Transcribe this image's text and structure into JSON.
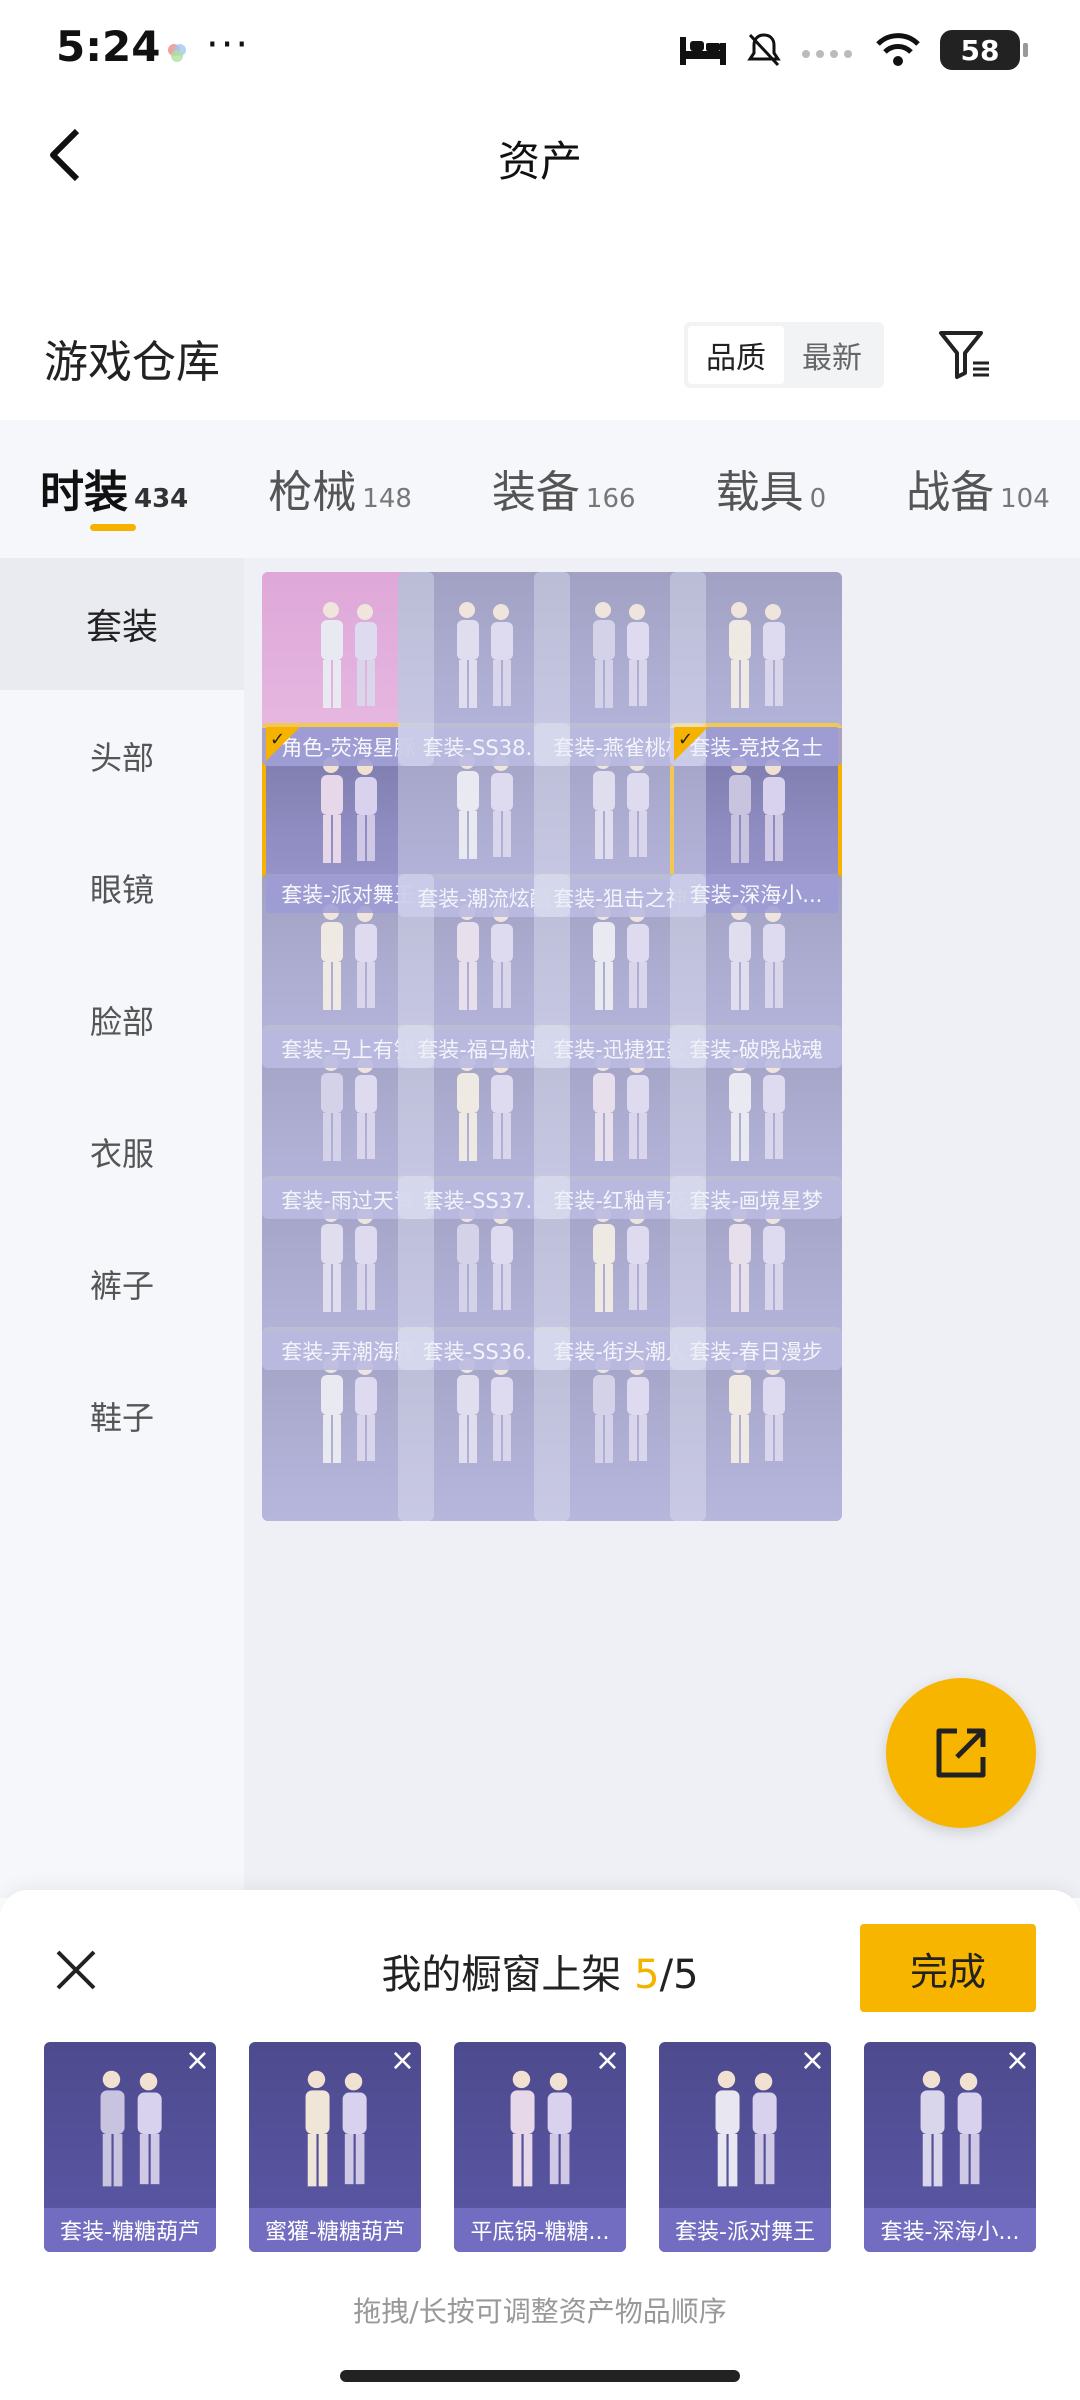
{
  "status_bar": {
    "time": "5:24",
    "more": "···",
    "battery": "58"
  },
  "header": {
    "title": "资产"
  },
  "warehouse": {
    "title": "游戏仓库",
    "sort_options": [
      "品质",
      "最新"
    ],
    "active_sort": "品质"
  },
  "tabs": [
    {
      "label": "时装",
      "count": "434",
      "active": true
    },
    {
      "label": "枪械",
      "count": "148"
    },
    {
      "label": "装备",
      "count": "166"
    },
    {
      "label": "载具",
      "count": "0"
    },
    {
      "label": "战备",
      "count": "104"
    }
  ],
  "sidebar": {
    "items": [
      {
        "label": "套装",
        "active": true
      },
      {
        "label": "头部"
      },
      {
        "label": "眼镜"
      },
      {
        "label": "脸部"
      },
      {
        "label": "衣服"
      },
      {
        "label": "裤子"
      },
      {
        "label": "鞋子"
      }
    ]
  },
  "grid": {
    "items": [
      {
        "label": "角色-荧海星豚",
        "style": "pink"
      },
      {
        "label": "套装-SS38..."
      },
      {
        "label": "套装-燕雀桃枝"
      },
      {
        "label": "套装-竞技名士"
      },
      {
        "label": "套装-派对舞王",
        "selected": true
      },
      {
        "label": "套装-潮流炫酷"
      },
      {
        "label": "套装-狙击之神"
      },
      {
        "label": "套装-深海小...",
        "selected": true
      },
      {
        "label": "套装-马上有钱"
      },
      {
        "label": "套装-福马献瑞"
      },
      {
        "label": "套装-迅捷狂鲨"
      },
      {
        "label": "套装-破晓战魂"
      },
      {
        "label": "套装-雨过天青"
      },
      {
        "label": "套装-SS37..."
      },
      {
        "label": "套装-红釉青花"
      },
      {
        "label": "套装-画境星梦"
      },
      {
        "label": "套装-弄潮海豚"
      },
      {
        "label": "套装-SS36..."
      },
      {
        "label": "套装-街头潮人"
      },
      {
        "label": "套装-春日漫步"
      },
      {
        "label": ""
      },
      {
        "label": ""
      },
      {
        "label": ""
      },
      {
        "label": ""
      }
    ]
  },
  "showcase": {
    "title_prefix": "我的橱窗上架 ",
    "current": "5",
    "separator": "/",
    "total": "5",
    "done_label": "完成",
    "hint": "拖拽/长按可调整资产物品顺序",
    "slots": [
      {
        "label": "套装-糖糖葫芦"
      },
      {
        "label": "蜜獾-糖糖葫芦"
      },
      {
        "label": "平底锅-糖糖..."
      },
      {
        "label": "套装-派对舞王"
      },
      {
        "label": "套装-深海小..."
      }
    ]
  },
  "colors": {
    "accent": "#f5b300",
    "card_bg": "#8e8cc0",
    "card_label": "#7470c4"
  }
}
